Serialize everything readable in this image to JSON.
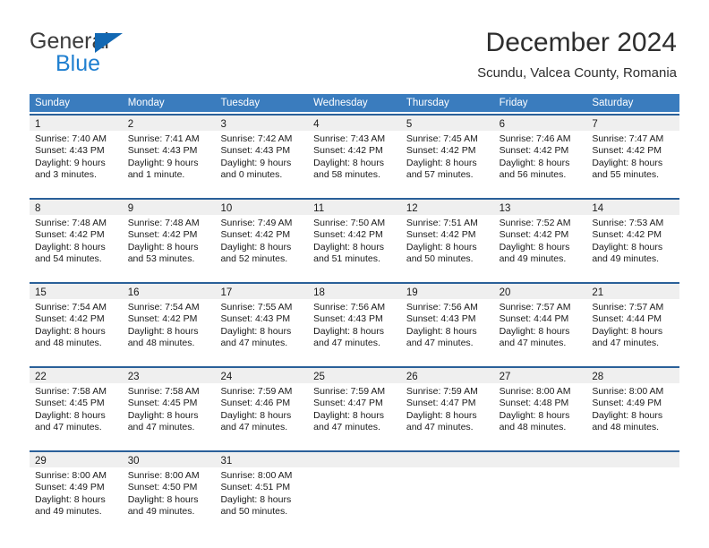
{
  "brand": {
    "name_part1": "General",
    "name_part2": "Blue",
    "logo_icon": "blue-triangle-icon"
  },
  "header": {
    "title": "December 2024",
    "subtitle": "Scundu, Valcea County, Romania"
  },
  "colors": {
    "header_blue": "#3a7cbe",
    "row_border_blue": "#2a6099",
    "day_band_gray": "#efefef",
    "brand_blue": "#1f7fd0",
    "logo_blue": "#1268b3"
  },
  "weekdays": [
    "Sunday",
    "Monday",
    "Tuesday",
    "Wednesday",
    "Thursday",
    "Friday",
    "Saturday"
  ],
  "weeks": [
    [
      {
        "day": "1",
        "sunrise": "Sunrise: 7:40 AM",
        "sunset": "Sunset: 4:43 PM",
        "daylight1": "Daylight: 9 hours",
        "daylight2": "and 3 minutes."
      },
      {
        "day": "2",
        "sunrise": "Sunrise: 7:41 AM",
        "sunset": "Sunset: 4:43 PM",
        "daylight1": "Daylight: 9 hours",
        "daylight2": "and 1 minute."
      },
      {
        "day": "3",
        "sunrise": "Sunrise: 7:42 AM",
        "sunset": "Sunset: 4:43 PM",
        "daylight1": "Daylight: 9 hours",
        "daylight2": "and 0 minutes."
      },
      {
        "day": "4",
        "sunrise": "Sunrise: 7:43 AM",
        "sunset": "Sunset: 4:42 PM",
        "daylight1": "Daylight: 8 hours",
        "daylight2": "and 58 minutes."
      },
      {
        "day": "5",
        "sunrise": "Sunrise: 7:45 AM",
        "sunset": "Sunset: 4:42 PM",
        "daylight1": "Daylight: 8 hours",
        "daylight2": "and 57 minutes."
      },
      {
        "day": "6",
        "sunrise": "Sunrise: 7:46 AM",
        "sunset": "Sunset: 4:42 PM",
        "daylight1": "Daylight: 8 hours",
        "daylight2": "and 56 minutes."
      },
      {
        "day": "7",
        "sunrise": "Sunrise: 7:47 AM",
        "sunset": "Sunset: 4:42 PM",
        "daylight1": "Daylight: 8 hours",
        "daylight2": "and 55 minutes."
      }
    ],
    [
      {
        "day": "8",
        "sunrise": "Sunrise: 7:48 AM",
        "sunset": "Sunset: 4:42 PM",
        "daylight1": "Daylight: 8 hours",
        "daylight2": "and 54 minutes."
      },
      {
        "day": "9",
        "sunrise": "Sunrise: 7:48 AM",
        "sunset": "Sunset: 4:42 PM",
        "daylight1": "Daylight: 8 hours",
        "daylight2": "and 53 minutes."
      },
      {
        "day": "10",
        "sunrise": "Sunrise: 7:49 AM",
        "sunset": "Sunset: 4:42 PM",
        "daylight1": "Daylight: 8 hours",
        "daylight2": "and 52 minutes."
      },
      {
        "day": "11",
        "sunrise": "Sunrise: 7:50 AM",
        "sunset": "Sunset: 4:42 PM",
        "daylight1": "Daylight: 8 hours",
        "daylight2": "and 51 minutes."
      },
      {
        "day": "12",
        "sunrise": "Sunrise: 7:51 AM",
        "sunset": "Sunset: 4:42 PM",
        "daylight1": "Daylight: 8 hours",
        "daylight2": "and 50 minutes."
      },
      {
        "day": "13",
        "sunrise": "Sunrise: 7:52 AM",
        "sunset": "Sunset: 4:42 PM",
        "daylight1": "Daylight: 8 hours",
        "daylight2": "and 49 minutes."
      },
      {
        "day": "14",
        "sunrise": "Sunrise: 7:53 AM",
        "sunset": "Sunset: 4:42 PM",
        "daylight1": "Daylight: 8 hours",
        "daylight2": "and 49 minutes."
      }
    ],
    [
      {
        "day": "15",
        "sunrise": "Sunrise: 7:54 AM",
        "sunset": "Sunset: 4:42 PM",
        "daylight1": "Daylight: 8 hours",
        "daylight2": "and 48 minutes."
      },
      {
        "day": "16",
        "sunrise": "Sunrise: 7:54 AM",
        "sunset": "Sunset: 4:42 PM",
        "daylight1": "Daylight: 8 hours",
        "daylight2": "and 48 minutes."
      },
      {
        "day": "17",
        "sunrise": "Sunrise: 7:55 AM",
        "sunset": "Sunset: 4:43 PM",
        "daylight1": "Daylight: 8 hours",
        "daylight2": "and 47 minutes."
      },
      {
        "day": "18",
        "sunrise": "Sunrise: 7:56 AM",
        "sunset": "Sunset: 4:43 PM",
        "daylight1": "Daylight: 8 hours",
        "daylight2": "and 47 minutes."
      },
      {
        "day": "19",
        "sunrise": "Sunrise: 7:56 AM",
        "sunset": "Sunset: 4:43 PM",
        "daylight1": "Daylight: 8 hours",
        "daylight2": "and 47 minutes."
      },
      {
        "day": "20",
        "sunrise": "Sunrise: 7:57 AM",
        "sunset": "Sunset: 4:44 PM",
        "daylight1": "Daylight: 8 hours",
        "daylight2": "and 47 minutes."
      },
      {
        "day": "21",
        "sunrise": "Sunrise: 7:57 AM",
        "sunset": "Sunset: 4:44 PM",
        "daylight1": "Daylight: 8 hours",
        "daylight2": "and 47 minutes."
      }
    ],
    [
      {
        "day": "22",
        "sunrise": "Sunrise: 7:58 AM",
        "sunset": "Sunset: 4:45 PM",
        "daylight1": "Daylight: 8 hours",
        "daylight2": "and 47 minutes."
      },
      {
        "day": "23",
        "sunrise": "Sunrise: 7:58 AM",
        "sunset": "Sunset: 4:45 PM",
        "daylight1": "Daylight: 8 hours",
        "daylight2": "and 47 minutes."
      },
      {
        "day": "24",
        "sunrise": "Sunrise: 7:59 AM",
        "sunset": "Sunset: 4:46 PM",
        "daylight1": "Daylight: 8 hours",
        "daylight2": "and 47 minutes."
      },
      {
        "day": "25",
        "sunrise": "Sunrise: 7:59 AM",
        "sunset": "Sunset: 4:47 PM",
        "daylight1": "Daylight: 8 hours",
        "daylight2": "and 47 minutes."
      },
      {
        "day": "26",
        "sunrise": "Sunrise: 7:59 AM",
        "sunset": "Sunset: 4:47 PM",
        "daylight1": "Daylight: 8 hours",
        "daylight2": "and 47 minutes."
      },
      {
        "day": "27",
        "sunrise": "Sunrise: 8:00 AM",
        "sunset": "Sunset: 4:48 PM",
        "daylight1": "Daylight: 8 hours",
        "daylight2": "and 48 minutes."
      },
      {
        "day": "28",
        "sunrise": "Sunrise: 8:00 AM",
        "sunset": "Sunset: 4:49 PM",
        "daylight1": "Daylight: 8 hours",
        "daylight2": "and 48 minutes."
      }
    ],
    [
      {
        "day": "29",
        "sunrise": "Sunrise: 8:00 AM",
        "sunset": "Sunset: 4:49 PM",
        "daylight1": "Daylight: 8 hours",
        "daylight2": "and 49 minutes."
      },
      {
        "day": "30",
        "sunrise": "Sunrise: 8:00 AM",
        "sunset": "Sunset: 4:50 PM",
        "daylight1": "Daylight: 8 hours",
        "daylight2": "and 49 minutes."
      },
      {
        "day": "31",
        "sunrise": "Sunrise: 8:00 AM",
        "sunset": "Sunset: 4:51 PM",
        "daylight1": "Daylight: 8 hours",
        "daylight2": "and 50 minutes."
      },
      {
        "day": "",
        "sunrise": "",
        "sunset": "",
        "daylight1": "",
        "daylight2": ""
      },
      {
        "day": "",
        "sunrise": "",
        "sunset": "",
        "daylight1": "",
        "daylight2": ""
      },
      {
        "day": "",
        "sunrise": "",
        "sunset": "",
        "daylight1": "",
        "daylight2": ""
      },
      {
        "day": "",
        "sunrise": "",
        "sunset": "",
        "daylight1": "",
        "daylight2": ""
      }
    ]
  ]
}
